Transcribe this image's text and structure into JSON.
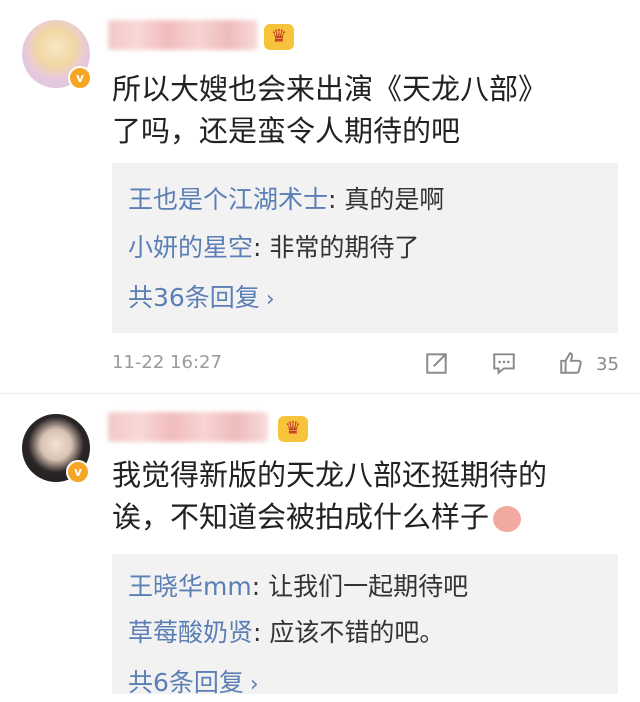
{
  "comments": [
    {
      "text_line1": "所以大嫂也会来出演《天龙八部》",
      "text_line2": "了吗，还是蛮令人期待的吧",
      "replies": [
        {
          "name": "王也是个江湖术士",
          "text": ": 真的是啊"
        },
        {
          "name": "小妍的星空",
          "text": ": 非常的期待了"
        }
      ],
      "more_replies": "共36条回复",
      "time": "11-22 16:27",
      "likes": "35"
    },
    {
      "text_line1": "我觉得新版的天龙八部还挺期待的",
      "text_line2": "诶，不知道会被拍成什么样子",
      "replies": [
        {
          "name": "王晓华mm",
          "text": ": 让我们一起期待吧"
        },
        {
          "name": "草莓酸奶贤",
          "text": ": 应该不错的吧。"
        }
      ],
      "more_replies": "共6条回复"
    }
  ],
  "icons": {
    "verified": "verified-badge-icon",
    "crown": "member-crown-icon",
    "forward": "forward-icon",
    "comment": "comment-icon",
    "like": "like-icon"
  },
  "colors": {
    "link": "#5b7fb5",
    "reply_bg": "#f2f2f2",
    "badge": "#f5a623"
  }
}
